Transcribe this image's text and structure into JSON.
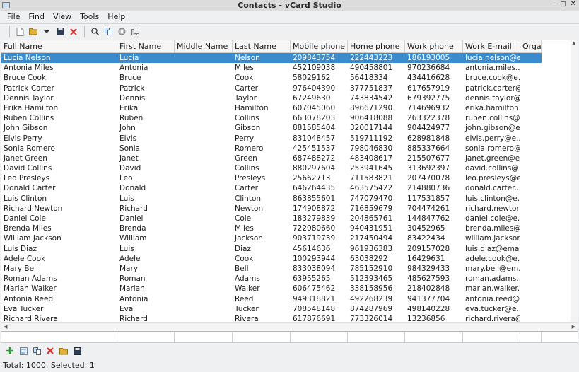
{
  "window": {
    "title": "Contacts - vCard Studio"
  },
  "menu": [
    "File",
    "Find",
    "View",
    "Tools",
    "Help"
  ],
  "toolbar": {
    "icons": [
      "new-file-icon",
      "open-folder-icon",
      "dropdown-icon",
      "save-icon",
      "close-icon",
      "search-icon",
      "copy-icon",
      "gear-icon",
      "export-icon"
    ]
  },
  "table": {
    "columns": [
      "Full Name",
      "First Name",
      "Middle Name",
      "Last Name",
      "Mobile phone",
      "Home phone",
      "Work phone",
      "Work E-mail",
      "Orga"
    ],
    "rows": [
      [
        "Lucia Nelson",
        "Lucia",
        "",
        "Nelson",
        "209843754",
        "222443223",
        "186193005",
        "lucia.nelson@e..."
      ],
      [
        "Antonia Miles",
        "Antonia",
        "",
        "Miles",
        "452109038",
        "490458801",
        "970236684",
        "antonia.miles..."
      ],
      [
        "Bruce Cook",
        "Bruce",
        "",
        "Cook",
        "58029162",
        "56418334",
        "434416628",
        "bruce.cook@e..."
      ],
      [
        "Patrick Carter",
        "Patrick",
        "",
        "Carter",
        "976404390",
        "377751837",
        "617657919",
        "patrick.carter@..."
      ],
      [
        "Dennis Taylor",
        "Dennis",
        "",
        "Taylor",
        "67249630",
        "743834542",
        "679392775",
        "dennis.taylor@..."
      ],
      [
        "Erika Hamilton",
        "Erika",
        "",
        "Hamilton",
        "607045060",
        "896671290",
        "714696932",
        "erika.hamilton..."
      ],
      [
        "Ruben Collins",
        "Ruben",
        "",
        "Collins",
        "663078203",
        "906418088",
        "263322378",
        "ruben.collins@..."
      ],
      [
        "John Gibson",
        "John",
        "",
        "Gibson",
        "881585404",
        "320017144",
        "904424977",
        "john.gibson@e..."
      ],
      [
        "Elvis Perry",
        "Elvis",
        "",
        "Perry",
        "831048457",
        "519711192",
        "628981848",
        "elvis.perry@e..."
      ],
      [
        "Sonia Romero",
        "Sonia",
        "",
        "Romero",
        "425451537",
        "798046830",
        "885337664",
        "sonia.romero@..."
      ],
      [
        "Janet Green",
        "Janet",
        "",
        "Green",
        "687488272",
        "483408617",
        "215507677",
        "janet.green@e..."
      ],
      [
        "David Collins",
        "David",
        "",
        "Collins",
        "880297604",
        "253941645",
        "313692397",
        "david.collins@..."
      ],
      [
        "Leo Presleys",
        "Leo",
        "",
        "Presleys",
        "25662713",
        "711583821",
        "207470078",
        "leo.presleys@e..."
      ],
      [
        "Donald Carter",
        "Donald",
        "",
        "Carter",
        "646264435",
        "463575422",
        "214880736",
        "donald.carter..."
      ],
      [
        "Luis Clinton",
        "Luis",
        "",
        "Clinton",
        "863855601",
        "747079470",
        "117531857",
        "luis.clinton@e..."
      ],
      [
        "Richard Newton",
        "Richard",
        "",
        "Newton",
        "174908872",
        "716859679",
        "704474261",
        "richard.newton..."
      ],
      [
        "Daniel Cole",
        "Daniel",
        "",
        "Cole",
        "183279839",
        "204865761",
        "144847762",
        "daniel.cole@e..."
      ],
      [
        "Brenda Miles",
        "Brenda",
        "",
        "Miles",
        "722080660",
        "940431951",
        "30452965",
        "brenda.miles@..."
      ],
      [
        "William Jackson",
        "William",
        "",
        "Jackson",
        "903719739",
        "217450494",
        "83422434",
        "william.jackson..."
      ],
      [
        "Luis Diaz",
        "Luis",
        "",
        "Diaz",
        "45614636",
        "961936383",
        "209157028",
        "luis.diaz@emai..."
      ],
      [
        "Adele Cook",
        "Adele",
        "",
        "Cook",
        "100293944",
        "63038292",
        "16429631",
        "adele.cook@e..."
      ],
      [
        "Mary Bell",
        "Mary",
        "",
        "Bell",
        "833038094",
        "785152910",
        "984329433",
        "mary.bell@em..."
      ],
      [
        "Roman Adams",
        "Roman",
        "",
        "Adams",
        "63955265",
        "512393465",
        "485627593",
        "roman.adams..."
      ],
      [
        "Marian Walker",
        "Marian",
        "",
        "Walker",
        "606475462",
        "338158956",
        "218402848",
        "marian.walker..."
      ],
      [
        "Antonia Reed",
        "Antonia",
        "",
        "Reed",
        "949318821",
        "492268239",
        "941377704",
        "antonia.reed@..."
      ],
      [
        "Eva Tucker",
        "Eva",
        "",
        "Tucker",
        "708548148",
        "874287969",
        "498140228",
        "eva.tucker@e..."
      ],
      [
        "Richard Rivera",
        "Richard",
        "",
        "Rivera",
        "617876691",
        "773326014",
        "13236856",
        "richard.rivera@..."
      ]
    ]
  },
  "bottom_toolbar": {
    "icons": [
      "add-icon",
      "edit-card-icon",
      "duplicate-icon",
      "delete-icon",
      "open-folder-icon",
      "save-icon"
    ]
  },
  "status": {
    "text": "Total: 1000, Selected: 1"
  },
  "colors": {
    "selection": "#3b8ccf",
    "add": "#2e9e3a",
    "delete": "#d8312f"
  }
}
